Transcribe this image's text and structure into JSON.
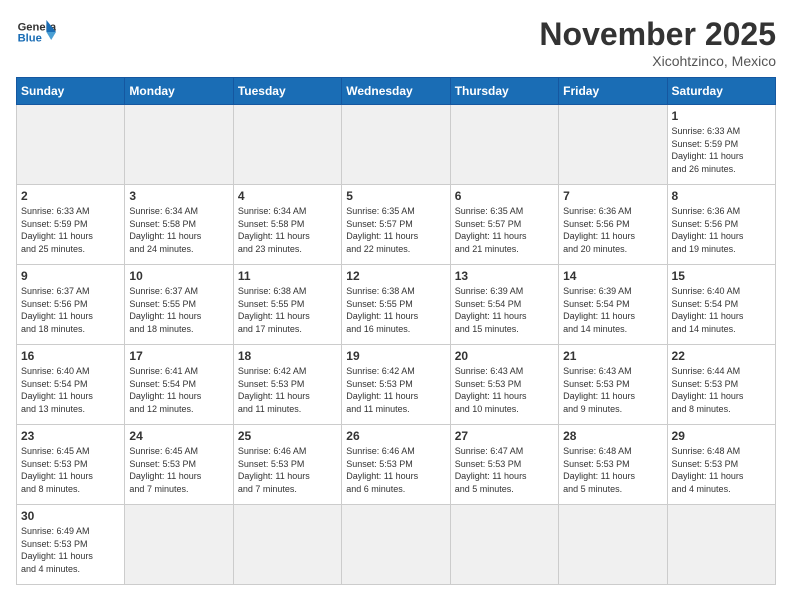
{
  "header": {
    "logo_general": "General",
    "logo_blue": "Blue",
    "month_year": "November 2025",
    "location": "Xicohtzinco, Mexico"
  },
  "weekdays": [
    "Sunday",
    "Monday",
    "Tuesday",
    "Wednesday",
    "Thursday",
    "Friday",
    "Saturday"
  ],
  "weeks": [
    [
      {
        "day": "",
        "info": ""
      },
      {
        "day": "",
        "info": ""
      },
      {
        "day": "",
        "info": ""
      },
      {
        "day": "",
        "info": ""
      },
      {
        "day": "",
        "info": ""
      },
      {
        "day": "",
        "info": ""
      },
      {
        "day": "1",
        "info": "Sunrise: 6:33 AM\nSunset: 5:59 PM\nDaylight: 11 hours\nand 26 minutes."
      }
    ],
    [
      {
        "day": "2",
        "info": "Sunrise: 6:33 AM\nSunset: 5:59 PM\nDaylight: 11 hours\nand 25 minutes."
      },
      {
        "day": "3",
        "info": "Sunrise: 6:34 AM\nSunset: 5:58 PM\nDaylight: 11 hours\nand 24 minutes."
      },
      {
        "day": "4",
        "info": "Sunrise: 6:34 AM\nSunset: 5:58 PM\nDaylight: 11 hours\nand 23 minutes."
      },
      {
        "day": "5",
        "info": "Sunrise: 6:35 AM\nSunset: 5:57 PM\nDaylight: 11 hours\nand 22 minutes."
      },
      {
        "day": "6",
        "info": "Sunrise: 6:35 AM\nSunset: 5:57 PM\nDaylight: 11 hours\nand 21 minutes."
      },
      {
        "day": "7",
        "info": "Sunrise: 6:36 AM\nSunset: 5:56 PM\nDaylight: 11 hours\nand 20 minutes."
      },
      {
        "day": "8",
        "info": "Sunrise: 6:36 AM\nSunset: 5:56 PM\nDaylight: 11 hours\nand 19 minutes."
      }
    ],
    [
      {
        "day": "9",
        "info": "Sunrise: 6:37 AM\nSunset: 5:56 PM\nDaylight: 11 hours\nand 18 minutes."
      },
      {
        "day": "10",
        "info": "Sunrise: 6:37 AM\nSunset: 5:55 PM\nDaylight: 11 hours\nand 18 minutes."
      },
      {
        "day": "11",
        "info": "Sunrise: 6:38 AM\nSunset: 5:55 PM\nDaylight: 11 hours\nand 17 minutes."
      },
      {
        "day": "12",
        "info": "Sunrise: 6:38 AM\nSunset: 5:55 PM\nDaylight: 11 hours\nand 16 minutes."
      },
      {
        "day": "13",
        "info": "Sunrise: 6:39 AM\nSunset: 5:54 PM\nDaylight: 11 hours\nand 15 minutes."
      },
      {
        "day": "14",
        "info": "Sunrise: 6:39 AM\nSunset: 5:54 PM\nDaylight: 11 hours\nand 14 minutes."
      },
      {
        "day": "15",
        "info": "Sunrise: 6:40 AM\nSunset: 5:54 PM\nDaylight: 11 hours\nand 14 minutes."
      }
    ],
    [
      {
        "day": "16",
        "info": "Sunrise: 6:40 AM\nSunset: 5:54 PM\nDaylight: 11 hours\nand 13 minutes."
      },
      {
        "day": "17",
        "info": "Sunrise: 6:41 AM\nSunset: 5:54 PM\nDaylight: 11 hours\nand 12 minutes."
      },
      {
        "day": "18",
        "info": "Sunrise: 6:42 AM\nSunset: 5:53 PM\nDaylight: 11 hours\nand 11 minutes."
      },
      {
        "day": "19",
        "info": "Sunrise: 6:42 AM\nSunset: 5:53 PM\nDaylight: 11 hours\nand 11 minutes."
      },
      {
        "day": "20",
        "info": "Sunrise: 6:43 AM\nSunset: 5:53 PM\nDaylight: 11 hours\nand 10 minutes."
      },
      {
        "day": "21",
        "info": "Sunrise: 6:43 AM\nSunset: 5:53 PM\nDaylight: 11 hours\nand 9 minutes."
      },
      {
        "day": "22",
        "info": "Sunrise: 6:44 AM\nSunset: 5:53 PM\nDaylight: 11 hours\nand 8 minutes."
      }
    ],
    [
      {
        "day": "23",
        "info": "Sunrise: 6:45 AM\nSunset: 5:53 PM\nDaylight: 11 hours\nand 8 minutes."
      },
      {
        "day": "24",
        "info": "Sunrise: 6:45 AM\nSunset: 5:53 PM\nDaylight: 11 hours\nand 7 minutes."
      },
      {
        "day": "25",
        "info": "Sunrise: 6:46 AM\nSunset: 5:53 PM\nDaylight: 11 hours\nand 7 minutes."
      },
      {
        "day": "26",
        "info": "Sunrise: 6:46 AM\nSunset: 5:53 PM\nDaylight: 11 hours\nand 6 minutes."
      },
      {
        "day": "27",
        "info": "Sunrise: 6:47 AM\nSunset: 5:53 PM\nDaylight: 11 hours\nand 5 minutes."
      },
      {
        "day": "28",
        "info": "Sunrise: 6:48 AM\nSunset: 5:53 PM\nDaylight: 11 hours\nand 5 minutes."
      },
      {
        "day": "29",
        "info": "Sunrise: 6:48 AM\nSunset: 5:53 PM\nDaylight: 11 hours\nand 4 minutes."
      }
    ],
    [
      {
        "day": "30",
        "info": "Sunrise: 6:49 AM\nSunset: 5:53 PM\nDaylight: 11 hours\nand 4 minutes."
      },
      {
        "day": "",
        "info": ""
      },
      {
        "day": "",
        "info": ""
      },
      {
        "day": "",
        "info": ""
      },
      {
        "day": "",
        "info": ""
      },
      {
        "day": "",
        "info": ""
      },
      {
        "day": "",
        "info": ""
      }
    ]
  ]
}
